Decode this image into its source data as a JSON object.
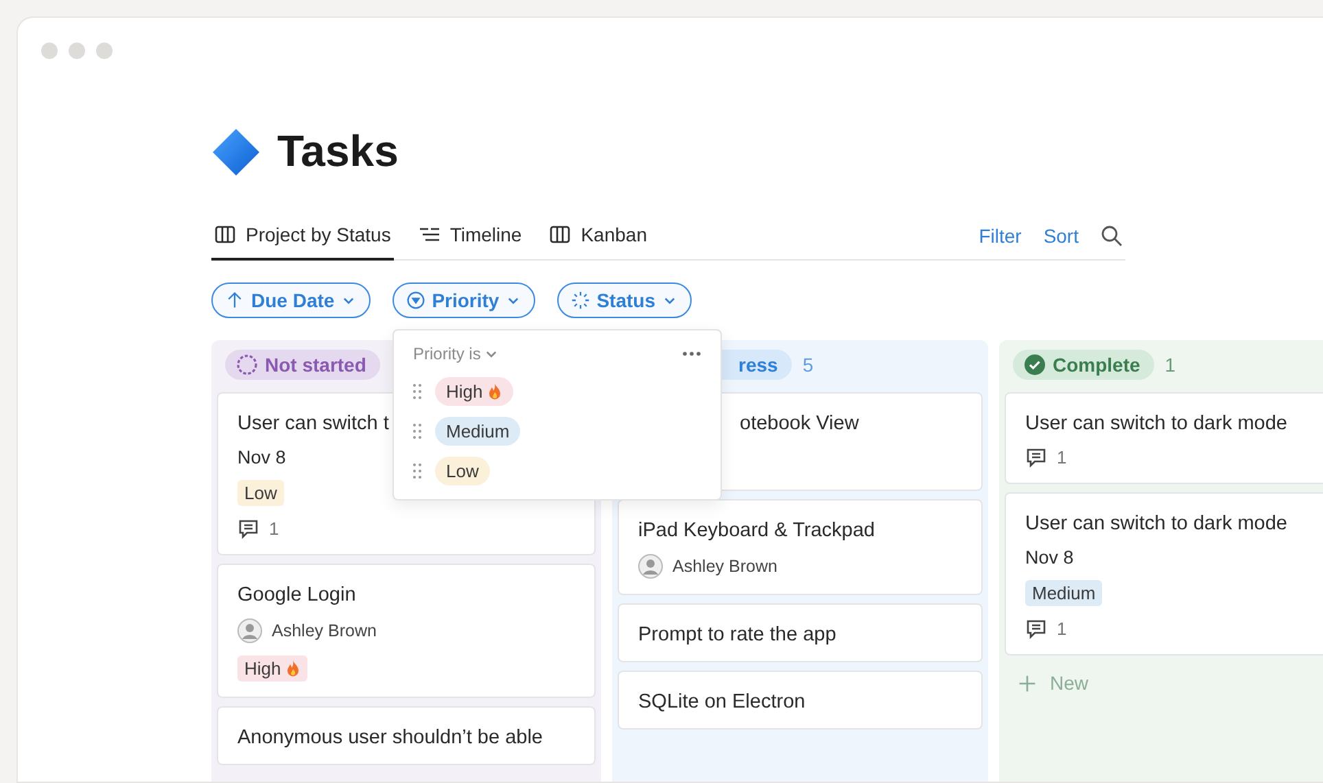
{
  "page": {
    "title": "Tasks"
  },
  "tabs": [
    {
      "label": "Project by Status",
      "selected": true
    },
    {
      "label": "Timeline",
      "selected": false
    },
    {
      "label": "Kanban",
      "selected": false
    }
  ],
  "actions": [
    "Filter",
    "Sort"
  ],
  "chips": [
    {
      "label": "Due Date"
    },
    {
      "label": "Priority"
    },
    {
      "label": "Status"
    }
  ],
  "columns": [
    {
      "status": "Not started",
      "kind": "not_started",
      "covered": false,
      "cards": [
        {
          "title": "User can switch t",
          "date": "Nov 8",
          "tag": {
            "label": "Low",
            "color": "#fbf1da",
            "flame": false
          },
          "comments": "1"
        },
        {
          "title": "Google Login",
          "assignee": "Ashley Brown",
          "tag": {
            "label": "High",
            "color": "#fae3e7",
            "flame": true
          }
        },
        {
          "title": "Anonymous user shouldn’t be able"
        }
      ]
    },
    {
      "status": "ress",
      "kind": "in_progress",
      "covered": true,
      "count": "5",
      "cards": [
        {
          "title": "otebook View",
          "covered": true
        },
        {
          "title": "iPad Keyboard & Trackpad",
          "assignee": "Ashley Brown"
        },
        {
          "title": "Prompt to rate the app"
        },
        {
          "title": "SQLite on Electron"
        }
      ]
    },
    {
      "status": "Complete",
      "kind": "complete",
      "covered": false,
      "count": "1",
      "cards": [
        {
          "title": "User can switch to dark mode",
          "comments": "1"
        },
        {
          "title": "User can switch to dark mode",
          "date": "Nov 8",
          "tag": {
            "label": "Medium",
            "color": "#dcebf5",
            "flame": false
          },
          "comments": "1"
        }
      ],
      "new_label": "New"
    }
  ],
  "menu": {
    "heading": "Priority is",
    "options": [
      {
        "label": "High",
        "color": "#fae3e7",
        "flame": true
      },
      {
        "label": "Medium",
        "color": "#dcebf5",
        "flame": false
      },
      {
        "label": "Low",
        "color": "#fbf1da",
        "flame": false
      }
    ]
  }
}
